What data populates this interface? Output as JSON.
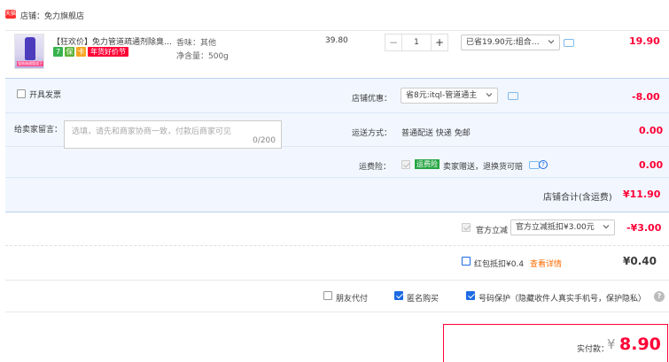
{
  "shop": {
    "badge": "天猫",
    "label": "店铺：免力旗舰店"
  },
  "item": {
    "title": "【狂欢价】免力管道疏通剂除臭…",
    "badge_7": "7",
    "badge_guarantee": "保",
    "badge_card": "卡",
    "promo": "年货好价节",
    "img_label": "强效疏通管道下水道",
    "spec_flavor": "香味：其他",
    "spec_volume": "净含量：500g",
    "unit_price": "39.80",
    "qty_minus": "−",
    "qty_value": "1",
    "qty_plus": "+",
    "promo_select": "已省19.90元:组合…",
    "subtotal": "19.90"
  },
  "panel": {
    "invoice_label": "开具发票",
    "message_label": "给卖家留言：",
    "message_placeholder": "选填，请先和商家协商一致，付款后商家可见",
    "message_counter": "0/200",
    "shop_discount_label": "店铺优惠：",
    "shop_discount_select": "省8元:itql-管道通主",
    "shop_discount_value": "-8.00",
    "delivery_label": "运送方式：",
    "delivery_text": "普通配送 快递 免邮",
    "delivery_value": "0.00",
    "insurance_label": "运费险：",
    "insurance_tag": "运费险",
    "insurance_text": "卖家赠送，退换货可赔",
    "insurance_help": "?",
    "insurance_value": "0.00",
    "shop_total_label": "店铺合计(含运费)",
    "shop_total_value": "¥11.90"
  },
  "official": {
    "label": "官方立减",
    "select": "官方立减抵扣¥3.00元",
    "value": "-¥3.00"
  },
  "redpacket": {
    "label": "红包抵扣¥0.4",
    "link": "查看详情",
    "value": "¥0.40"
  },
  "options": {
    "friend_pay": "朋友代付",
    "anonymous": "匿名购买",
    "privacy": "号码保护（隐藏收件人真实手机号，保护隐私）",
    "help": "?"
  },
  "payment": {
    "label": "实付款：",
    "currency": "¥",
    "amount": "8.90"
  }
}
